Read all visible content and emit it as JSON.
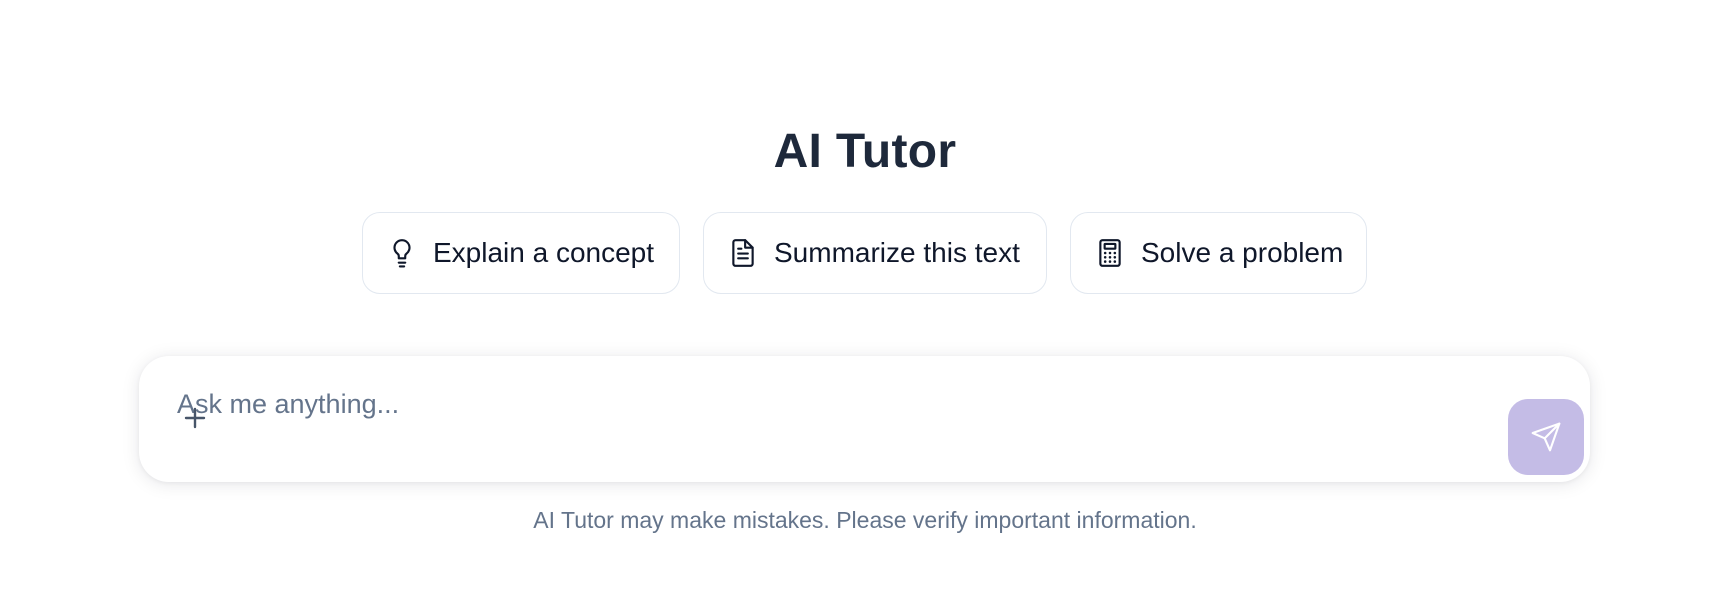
{
  "app": {
    "title": "AI Tutor"
  },
  "suggestions": [
    {
      "label": "Explain a concept",
      "icon": "lightbulb-icon"
    },
    {
      "label": "Summarize this text",
      "icon": "document-icon"
    },
    {
      "label": "Solve a problem",
      "icon": "calculator-icon"
    }
  ],
  "composer": {
    "placeholder": "Ask me anything...",
    "value": "",
    "attach_icon": "plus-icon",
    "send_icon": "send-icon",
    "send_button_color": "#c4bce6"
  },
  "footer": {
    "disclaimer": "AI Tutor may make mistakes. Please verify important information."
  },
  "colors": {
    "title": "#1e293b",
    "muted_text": "#64748b",
    "chip_border": "#e2e8f0"
  }
}
